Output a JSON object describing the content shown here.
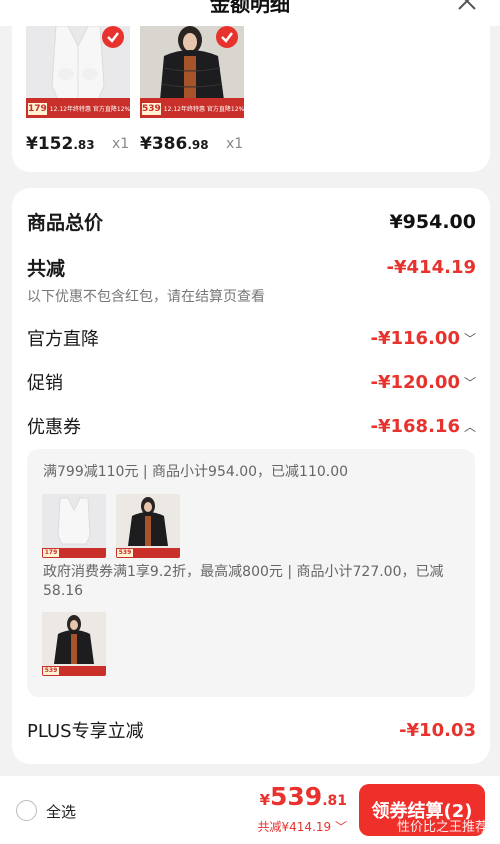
{
  "header": {
    "title": "金额明细"
  },
  "products": [
    {
      "price_main": "¥152",
      "price_dec": ".83",
      "qty": "x1",
      "tag_price": "179",
      "tag_text": "12.12年终特惠 官方直降12%"
    },
    {
      "price_main": "¥386",
      "price_dec": ".98",
      "qty": "x1",
      "tag_price": "539",
      "tag_text": "12.12年终特惠 官方直降12%"
    }
  ],
  "summary": {
    "subtotal_label": "商品总价",
    "subtotal_value": "¥954.00",
    "discount_label": "共减",
    "discount_value": "-¥414.19",
    "discount_note": "以下优惠不包含红包，请在结算页查看",
    "items": [
      {
        "label": "官方直降",
        "value": "-¥116.00"
      },
      {
        "label": "促销",
        "value": "-¥120.00"
      },
      {
        "label": "优惠券",
        "value": "-¥168.16"
      }
    ],
    "coupon_line1": "满799减110元 | 商品小计954.00，已减110.00",
    "coupon_line2": "政府消费券满1享9.2折，最高减800元 | 商品小计727.00，已减58.16",
    "thumb_tags": [
      "179",
      "539",
      "539"
    ],
    "plus_label": "PLUS专享立减",
    "plus_value": "-¥10.03"
  },
  "bottom": {
    "select_all": "全选",
    "total_yen": "¥",
    "total_int": "539",
    "total_dec": ".81",
    "saved": "共减¥414.19",
    "checkout": "领券结算(2)",
    "watermark": "性价比之王推荐"
  },
  "colors": {
    "accent": "#e8322d",
    "button": "#ef2f2a"
  }
}
